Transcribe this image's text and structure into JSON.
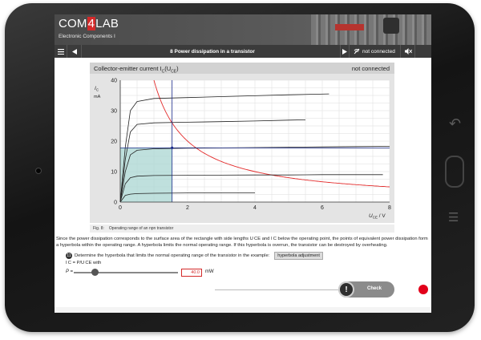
{
  "app": {
    "brand_prefix": "COM",
    "brand_four": "4",
    "brand_suffix": "LAB",
    "course": "Electronic Components I"
  },
  "nav": {
    "menu_icon": "menu-icon",
    "prev_icon": "triangle-left-icon",
    "title": "8  Power dissipation in a transistor",
    "next_icon": "triangle-right-icon",
    "connection_icon": "no-connection-icon",
    "connection_label": "not connected",
    "mute_icon": "speaker-muted-icon"
  },
  "chart": {
    "title": "Collector-emitter current I",
    "title_sub": "C",
    "title_arg": "(U",
    "title_arg_sub": "CE",
    "title_end": ")",
    "status": "not connected",
    "caption_label": "Fig. 8:",
    "caption_text": "Operating range of an npn transistor"
  },
  "chart_data": {
    "type": "line",
    "xlabel": "U_CE / V",
    "ylabel": "I_C / mA",
    "xlim": [
      0,
      8
    ],
    "ylim": [
      0,
      40
    ],
    "xticks": [
      0,
      2,
      4,
      6,
      8
    ],
    "yticks": [
      0,
      10,
      20,
      30,
      40
    ],
    "grid": true,
    "series": [
      {
        "x": [
          0,
          0.15,
          0.3,
          0.5,
          1,
          2,
          3,
          4,
          5,
          6.2
        ],
        "y": [
          0,
          18,
          30,
          33,
          34,
          34.3,
          34.6,
          34.9,
          35.2,
          35.5
        ]
      },
      {
        "x": [
          0,
          0.15,
          0.3,
          0.5,
          1,
          2,
          3,
          4,
          5,
          5.5
        ],
        "y": [
          0,
          14,
          23,
          25.5,
          26,
          26.2,
          26.4,
          26.6,
          26.9,
          27
        ]
      },
      {
        "x": [
          0,
          0.15,
          0.3,
          0.5,
          1,
          2,
          3,
          4,
          5,
          6,
          7,
          8
        ],
        "y": [
          0,
          10,
          15.5,
          17,
          17.5,
          17.7,
          17.8,
          17.9,
          18,
          18.1,
          18.2,
          18.3
        ]
      },
      {
        "x": [
          0,
          0.15,
          0.3,
          0.5,
          1,
          2,
          3,
          4,
          5,
          6,
          7,
          7.8
        ],
        "y": [
          0,
          6,
          8,
          8.5,
          8.7,
          8.8,
          8.85,
          8.9,
          8.9,
          9,
          9,
          9
        ]
      },
      {
        "x": [
          0,
          0.15,
          0.3,
          0.5,
          1,
          2,
          3,
          4
        ],
        "y": [
          0,
          2.2,
          2.6,
          2.8,
          2.9,
          3,
          3,
          3
        ]
      }
    ],
    "hyperbola_power_mw": 40,
    "operating_point": {
      "x": 1.54,
      "y": 17.8
    }
  },
  "body": {
    "text": "Since the power dissipation corresponds to the surface area of the rectangle with side lengths U CE and I C below the operating point, the points of equivalent power dissipation form a hyperbola within the operating range. A hyperbola limits the normal operating range. If this hyperbola is overrun, the transistor can be destroyed by overheating."
  },
  "task": {
    "number": "11",
    "text": "Determine the hyperbola that limits the normal operating range of the transistor in the example:",
    "button": "hyperbola adjustment",
    "formula": "I C = P/U CE  with"
  },
  "power": {
    "label": "P =",
    "value": "40.0",
    "unit": "mW",
    "slider_fraction": 0.2
  },
  "check": {
    "label": "Check",
    "icon": "exclamation-icon"
  }
}
